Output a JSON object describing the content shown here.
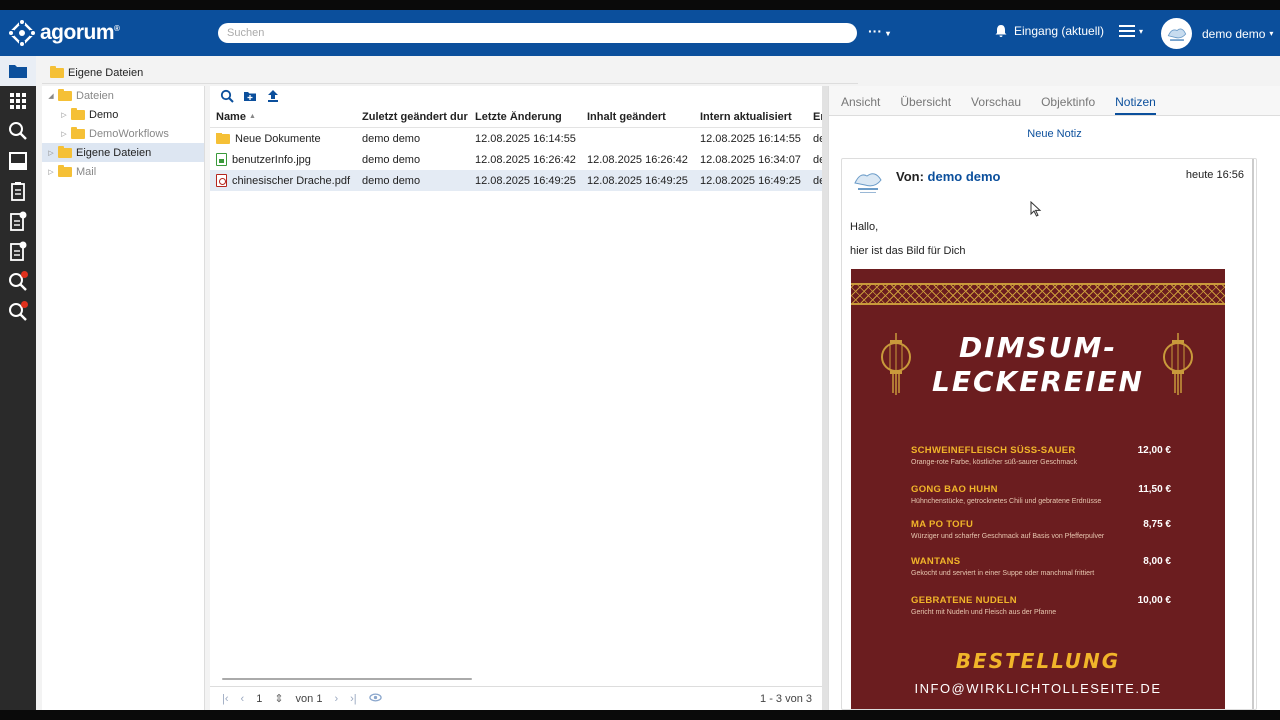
{
  "header": {
    "brand": "agorum",
    "brand_mark": "®",
    "search_placeholder": "Suchen",
    "more_label": "···",
    "inbox_label": "Eingang (aktuell)",
    "user_name": "demo demo"
  },
  "breadcrumb": {
    "label": "Eigene Dateien"
  },
  "tree": {
    "items": [
      {
        "label": "Dateien",
        "level": 0,
        "expanded": true
      },
      {
        "label": "Demo",
        "level": 1
      },
      {
        "label": "DemoWorkflows",
        "level": 1
      },
      {
        "label": "Eigene Dateien",
        "level": 0,
        "selected": true
      },
      {
        "label": "Mail",
        "level": 0
      }
    ]
  },
  "grid": {
    "columns": [
      "Name",
      "Zuletzt geändert dur",
      "Letzte Änderung",
      "Inhalt geändert",
      "Intern aktualisiert",
      "Ers"
    ],
    "rows": [
      {
        "name": "Neue Dokumente",
        "type": "folder",
        "changed_by": "demo demo",
        "last_change": "12.08.2025 16:14:55",
        "content_changed": "",
        "internal": "12.08.2025 16:14:55",
        "created": "der"
      },
      {
        "name": "benutzerInfo.jpg",
        "type": "image",
        "changed_by": "demo demo",
        "last_change": "12.08.2025 16:26:42",
        "content_changed": "12.08.2025 16:26:42",
        "internal": "12.08.2025 16:34:07",
        "created": "der"
      },
      {
        "name": "chinesischer Drache.pdf",
        "type": "pdf",
        "changed_by": "demo demo",
        "last_change": "12.08.2025 16:49:25",
        "content_changed": "12.08.2025 16:49:25",
        "internal": "12.08.2025 16:49:25",
        "created": "der"
      }
    ]
  },
  "pager": {
    "page": "1",
    "of_label": "von 1",
    "count": "1 - 3 von 3"
  },
  "tabs": [
    "Ansicht",
    "Übersicht",
    "Vorschau",
    "Objektinfo",
    "Notizen"
  ],
  "active_tab": "Notizen",
  "notes": {
    "new_label": "Neue Notiz",
    "from_label": "Von:",
    "from_name": "demo demo",
    "time": "heute 16:56",
    "line1": "Hallo,",
    "line2": "hier ist das Bild für Dich"
  },
  "menu_image": {
    "title_1": "DIMSUM-",
    "title_2": "LECKEREIEN",
    "dishes": [
      {
        "name": "SCHWEINEFLEISCH SÜSS-SAUER",
        "desc": "Orange-rote Farbe, köstlicher süß-saurer Geschmack",
        "price": "12,00 €"
      },
      {
        "name": "GONG BAO HUHN",
        "desc": "Hühnchenstücke, getrocknetes Chili und gebratene Erdnüsse",
        "price": "11,50 €"
      },
      {
        "name": "MA PO TOFU",
        "desc": "Würziger und scharfer Geschmack auf Basis von Pfefferpulver",
        "price": "8,75 €"
      },
      {
        "name": "WANTANS",
        "desc": "Gekocht und serviert in einer Suppe oder manchmal frittiert",
        "price": "8,00 €"
      },
      {
        "name": "GEBRATENE NUDELN",
        "desc": "Gericht mit Nudeln und Fleisch aus der Pfanne",
        "price": "10,00 €"
      }
    ],
    "order_title": "BESTELLUNG",
    "order_mail": "INFO@WIRKLICHTOLLESEITE.DE"
  },
  "colors": {
    "header_blue": "#0b4f9c",
    "menu_red": "#6b1d1f",
    "menu_gold": "#f1b52a",
    "folder_yellow": "#f5c036"
  }
}
